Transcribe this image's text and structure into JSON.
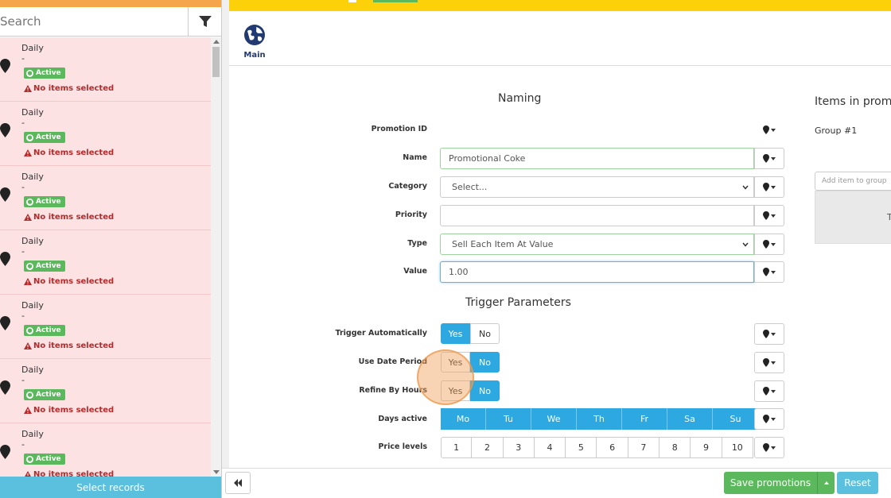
{
  "sidebar": {
    "search_placeholder": "Search",
    "select_records_label": "Select records",
    "items": [
      {
        "title": "Daily",
        "dash": "-",
        "status": "Active",
        "warning": "No items selected"
      },
      {
        "title": "Daily",
        "dash": "-",
        "status": "Active",
        "warning": "No items selected"
      },
      {
        "title": "Daily",
        "dash": "-",
        "status": "Active",
        "warning": "No items selected"
      },
      {
        "title": "Daily",
        "dash": "-",
        "status": "Active",
        "warning": "No items selected"
      },
      {
        "title": "Daily",
        "dash": "-",
        "status": "Active",
        "warning": "No items selected"
      },
      {
        "title": "Daily",
        "dash": "-",
        "status": "Active",
        "warning": "No items selected"
      },
      {
        "title": "Daily",
        "dash": "-",
        "status": "Active",
        "warning": "No items selected"
      }
    ]
  },
  "tabs": {
    "main_label": "Main"
  },
  "naming": {
    "title": "Naming",
    "promotion_id_label": "Promotion ID",
    "name_label": "Name",
    "name_value": "Promotional Coke",
    "category_label": "Category",
    "category_value": "Select...",
    "priority_label": "Priority",
    "priority_value": "",
    "type_label": "Type",
    "type_value": "Sell Each Item At Value",
    "value_label": "Value",
    "value_value": "1.00"
  },
  "trigger": {
    "title": "Trigger Parameters",
    "auto_label": "Trigger Automatically",
    "date_label": "Use Date Period",
    "hours_label": "Refine By Hours",
    "days_label": "Days active",
    "levels_label": "Price levels",
    "yes": "Yes",
    "no": "No",
    "days": [
      "Mo",
      "Tu",
      "We",
      "Th",
      "Fr",
      "Sa",
      "Su"
    ],
    "levels": [
      "1",
      "2",
      "3",
      "4",
      "5",
      "6",
      "7",
      "8",
      "9",
      "10"
    ]
  },
  "items_panel": {
    "title": "Items in prom",
    "group_label": "Group #1",
    "add_placeholder": "Add item to group",
    "box_text": "T"
  },
  "footer": {
    "save_label": "Save promotions",
    "reset_label": "Reset"
  },
  "colors": {
    "accent_blue": "#2ea8e0",
    "success_green": "#5cb85c",
    "info_blue": "#5bc0de",
    "sidebar_bg": "#fde2e4",
    "header_yellow": "#fdd10a"
  }
}
